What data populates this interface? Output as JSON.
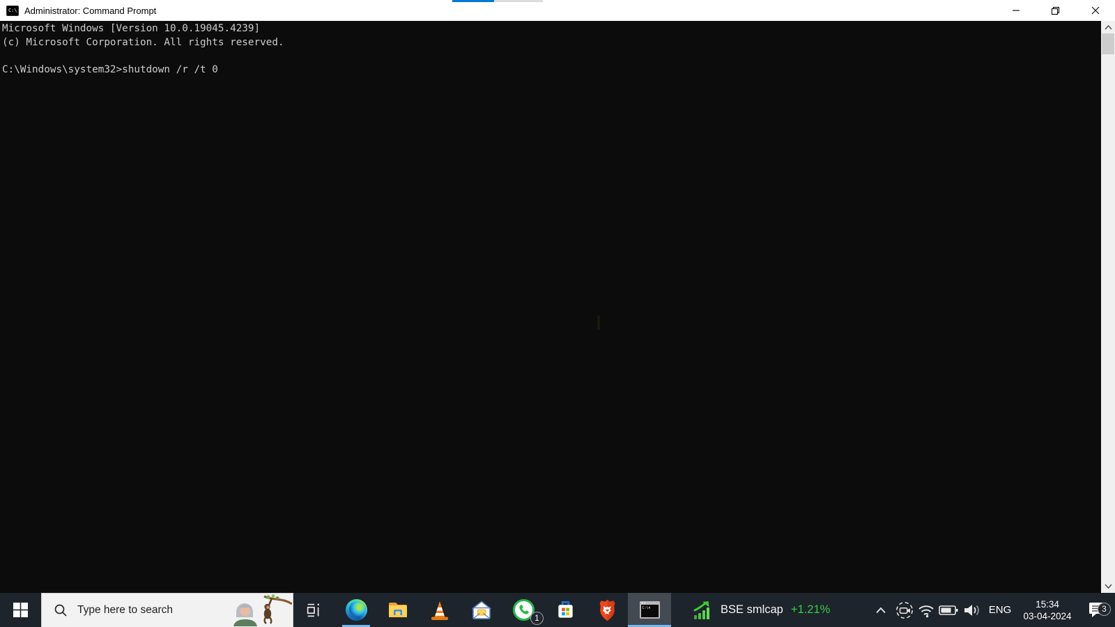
{
  "screen": {
    "top_progress": {
      "blue_color": "#0078d7",
      "gray_color": "#dcdcdc"
    }
  },
  "window": {
    "title": "Administrator: Command Prompt",
    "icon": "cmd-icon",
    "icon_glyph": "C:\\",
    "controls": {
      "minimize": "minimize-icon",
      "restore": "restore-icon",
      "close": "close-icon"
    }
  },
  "console": {
    "lines": [
      "Microsoft Windows [Version 10.0.19045.4239]",
      "(c) Microsoft Corporation. All rights reserved.",
      "",
      "C:\\Windows\\system32>shutdown /r /t 0"
    ],
    "colors": {
      "background": "#0c0c0c",
      "text": "#cccccc"
    }
  },
  "taskbar": {
    "colors": {
      "background": "#1e242b",
      "active_button": "#434a52",
      "running_underline": "#76b9ed"
    },
    "start": {
      "icon": "windows-logo-icon"
    },
    "search": {
      "placeholder": "Type here to search",
      "icon": "search-icon",
      "illustration": "woman-and-monkey-illustration"
    },
    "apps": [
      {
        "name": "task-view",
        "icon": "task-view-icon"
      },
      {
        "name": "edge",
        "icon": "edge-icon",
        "running": true
      },
      {
        "name": "file-explorer",
        "icon": "folder-icon"
      },
      {
        "name": "vlc",
        "icon": "vlc-cone-icon"
      },
      {
        "name": "mail",
        "icon": "mail-icon"
      },
      {
        "name": "whatsapp",
        "icon": "whatsapp-icon",
        "badge": "1"
      },
      {
        "name": "microsoft-store",
        "icon": "store-icon"
      },
      {
        "name": "brave",
        "icon": "brave-icon"
      },
      {
        "name": "command-prompt",
        "icon": "cmd-icon",
        "active": true
      }
    ],
    "stock": {
      "icon": "stock-chart-icon",
      "label": "BSE smlcap",
      "change": "+1.21%",
      "change_color": "#35cb4a"
    },
    "tray": {
      "hidden_icons": "chevron-up-icon",
      "meet_now": "meet-now-icon",
      "network": "wifi-icon",
      "battery": "battery-icon",
      "volume": "volume-icon",
      "language": "ENG",
      "time": "15:34",
      "date": "03-04-2024",
      "notification": "notification-icon",
      "notification_badge": "3"
    }
  }
}
